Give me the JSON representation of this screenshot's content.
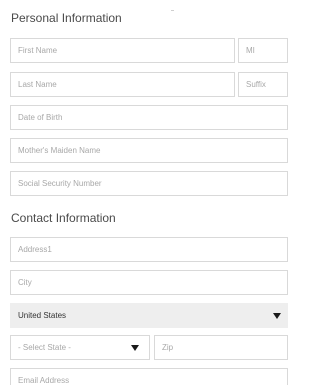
{
  "personal_section": {
    "heading": "Personal Information",
    "first_name_placeholder": "First Name",
    "middle_initial_placeholder": "MI",
    "last_name_placeholder": "Last Name",
    "suffix_placeholder": "Suffix",
    "dob_placeholder": "Date of Birth",
    "maiden_name_placeholder": "Mother's Maiden Name",
    "ssn_placeholder": "Social Security Number"
  },
  "contact_section": {
    "heading": "Contact Information",
    "address_placeholder": "Address1",
    "city_placeholder": "City",
    "country_value": "United States",
    "state_value": "- Select State -",
    "zip_placeholder": "Zip",
    "email_placeholder": "Email Address"
  },
  "icons": {
    "dropdown_arrow": "chevron-down-icon"
  },
  "colors": {
    "border": "#d9d9d9",
    "placeholder": "#a8a8a8",
    "heading": "#4a4a4a",
    "select_fill": "#eeeeee"
  }
}
